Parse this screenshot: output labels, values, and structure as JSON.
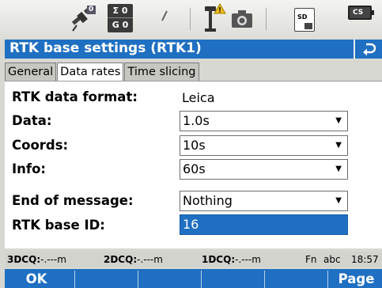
{
  "statusbar": {
    "icons": [
      "satellite-tracking-icon",
      "sat-count-icon",
      "radio-link-icon",
      "rtk-antenna-warning-icon",
      "camera-icon",
      "sd-card-icon",
      "battery-icon"
    ],
    "sat_counts": [
      {
        "sym": "Σ",
        "val": "0"
      },
      {
        "sym": "G",
        "val": "0"
      }
    ],
    "satellite_badge": "0",
    "sd_label": "SD",
    "battery_label": "CS"
  },
  "title": "RTK base settings (RTK1)",
  "tabs": [
    {
      "label": "General",
      "active": false
    },
    {
      "label": "Data rates",
      "active": true
    },
    {
      "label": "Time slicing",
      "active": false
    }
  ],
  "form": {
    "rtk_data_format": {
      "label": "RTK data format:",
      "value": "Leica"
    },
    "data": {
      "label": "Data:",
      "value": "1.0s"
    },
    "coords": {
      "label": "Coords:",
      "value": "10s"
    },
    "info": {
      "label": "Info:",
      "value": "60s"
    },
    "end_of_message": {
      "label": "End of message:",
      "value": "Nothing"
    },
    "rtk_base_id": {
      "label": "RTK base ID:",
      "value": "16"
    }
  },
  "statusline": {
    "q3d_label": "3DCQ:",
    "q3d_value": "-.---m",
    "q2d_label": "2DCQ:",
    "q2d_value": "-.---m",
    "q1d_label": "1DCQ:",
    "q1d_value": "-.---m",
    "fn": "Fn",
    "input_mode": "abc",
    "time": "18:57"
  },
  "softkeys": {
    "f1": "OK",
    "f6": "Page"
  },
  "colors": {
    "accent": "#1f6fc2",
    "background": "#d8d8d3",
    "panel": "#ffffff",
    "warning": "#f0c020"
  }
}
